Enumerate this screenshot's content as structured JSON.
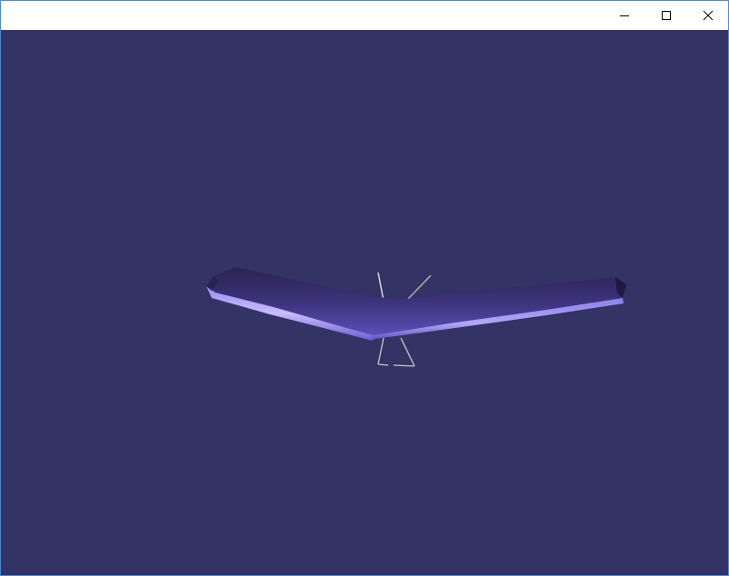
{
  "window": {
    "title": "",
    "buttons": {
      "minimize": "minimize-icon",
      "maximize": "maximize-icon",
      "close": "close-icon"
    }
  },
  "viewport": {
    "background_color": "#333366",
    "scene": "hang-glider",
    "wing_color": "#7b6fe0",
    "frame_color": "#c8c8c8"
  }
}
